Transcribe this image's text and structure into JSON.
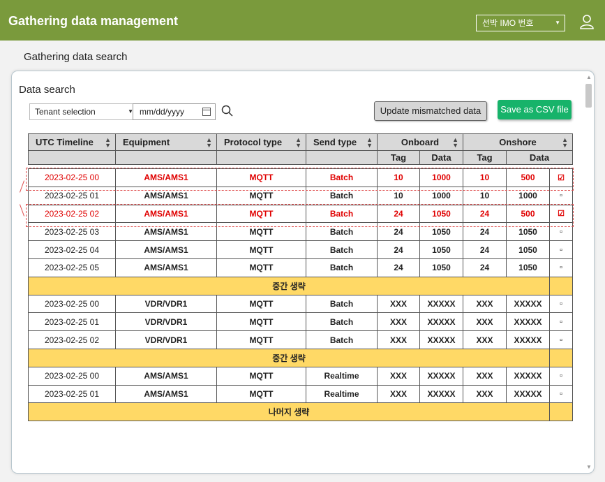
{
  "header": {
    "title": "Gathering data management",
    "imo_select": "선박 IMO 번호"
  },
  "page_subtitle": "Gathering data search",
  "panel": {
    "section_title": "Data search",
    "tenant_select": "Tenant selection",
    "date_placeholder": "mm/dd/yyyy",
    "update_button": "Update mismatched data",
    "csv_button": "Save as CSV file"
  },
  "table": {
    "headers": {
      "utc": "UTC Timeline",
      "equipment": "Equipment",
      "protocol": "Protocol type",
      "send": "Send type",
      "onboard": "Onboard",
      "onshore": "Onshore",
      "tag": "Tag",
      "data": "Data"
    },
    "rows": [
      {
        "time": "2023-02-25 00",
        "equip": "AMS/AMS1",
        "proto": "MQTT",
        "send": "Batch",
        "ob_tag": "10",
        "ob_data": "1000",
        "os_tag": "10",
        "os_data": "500",
        "check": "☑"
      },
      {
        "time": "2023-02-25 01",
        "equip": "AMS/AMS1",
        "proto": "MQTT",
        "send": "Batch",
        "ob_tag": "10",
        "ob_data": "1000",
        "os_tag": "10",
        "os_data": "1000",
        "check": "▫"
      },
      {
        "time": "2023-02-25 02",
        "equip": "AMS/AMS1",
        "proto": "MQTT",
        "send": "Batch",
        "ob_tag": "24",
        "ob_data": "1050",
        "os_tag": "24",
        "os_data": "500",
        "check": "☑"
      },
      {
        "time": "2023-02-25 03",
        "equip": "AMS/AMS1",
        "proto": "MQTT",
        "send": "Batch",
        "ob_tag": "24",
        "ob_data": "1050",
        "os_tag": "24",
        "os_data": "1050",
        "check": "▫"
      },
      {
        "time": "2023-02-25 04",
        "equip": "AMS/AMS1",
        "proto": "MQTT",
        "send": "Batch",
        "ob_tag": "24",
        "ob_data": "1050",
        "os_tag": "24",
        "os_data": "1050",
        "check": "▫"
      },
      {
        "time": "2023-02-25 05",
        "equip": "AMS/AMS1",
        "proto": "MQTT",
        "send": "Batch",
        "ob_tag": "24",
        "ob_data": "1050",
        "os_tag": "24",
        "os_data": "1050",
        "check": "▫"
      },
      {
        "time": "2023-02-25 00",
        "equip": "VDR/VDR1",
        "proto": "MQTT",
        "send": "Batch",
        "ob_tag": "XXX",
        "ob_data": "XXXXX",
        "os_tag": "XXX",
        "os_data": "XXXXX",
        "check": "▫"
      },
      {
        "time": "2023-02-25 01",
        "equip": "VDR/VDR1",
        "proto": "MQTT",
        "send": "Batch",
        "ob_tag": "XXX",
        "ob_data": "XXXXX",
        "os_tag": "XXX",
        "os_data": "XXXXX",
        "check": "▫"
      },
      {
        "time": "2023-02-25 02",
        "equip": "VDR/VDR1",
        "proto": "MQTT",
        "send": "Batch",
        "ob_tag": "XXX",
        "ob_data": "XXXXX",
        "os_tag": "XXX",
        "os_data": "XXXXX",
        "check": "▫"
      },
      {
        "time": "2023-02-25 00",
        "equip": "AMS/AMS1",
        "proto": "MQTT",
        "send": "Realtime",
        "ob_tag": "XXX",
        "ob_data": "XXXXX",
        "os_tag": "XXX",
        "os_data": "XXXXX",
        "check": "▫"
      },
      {
        "time": "2023-02-25 01",
        "equip": "AMS/AMS1",
        "proto": "MQTT",
        "send": "Realtime",
        "ob_tag": "XXX",
        "ob_data": "XXXXX",
        "os_tag": "XXX",
        "os_data": "XXXXX",
        "check": "▫"
      }
    ],
    "omit_middle": "중간 생략",
    "omit_rest": "나머지 생략"
  },
  "colors": {
    "header_bg": "#7a9a3c",
    "csv_button": "#17b36a",
    "mismatch_text": "#e00000",
    "omit_row": "#ffd966"
  }
}
